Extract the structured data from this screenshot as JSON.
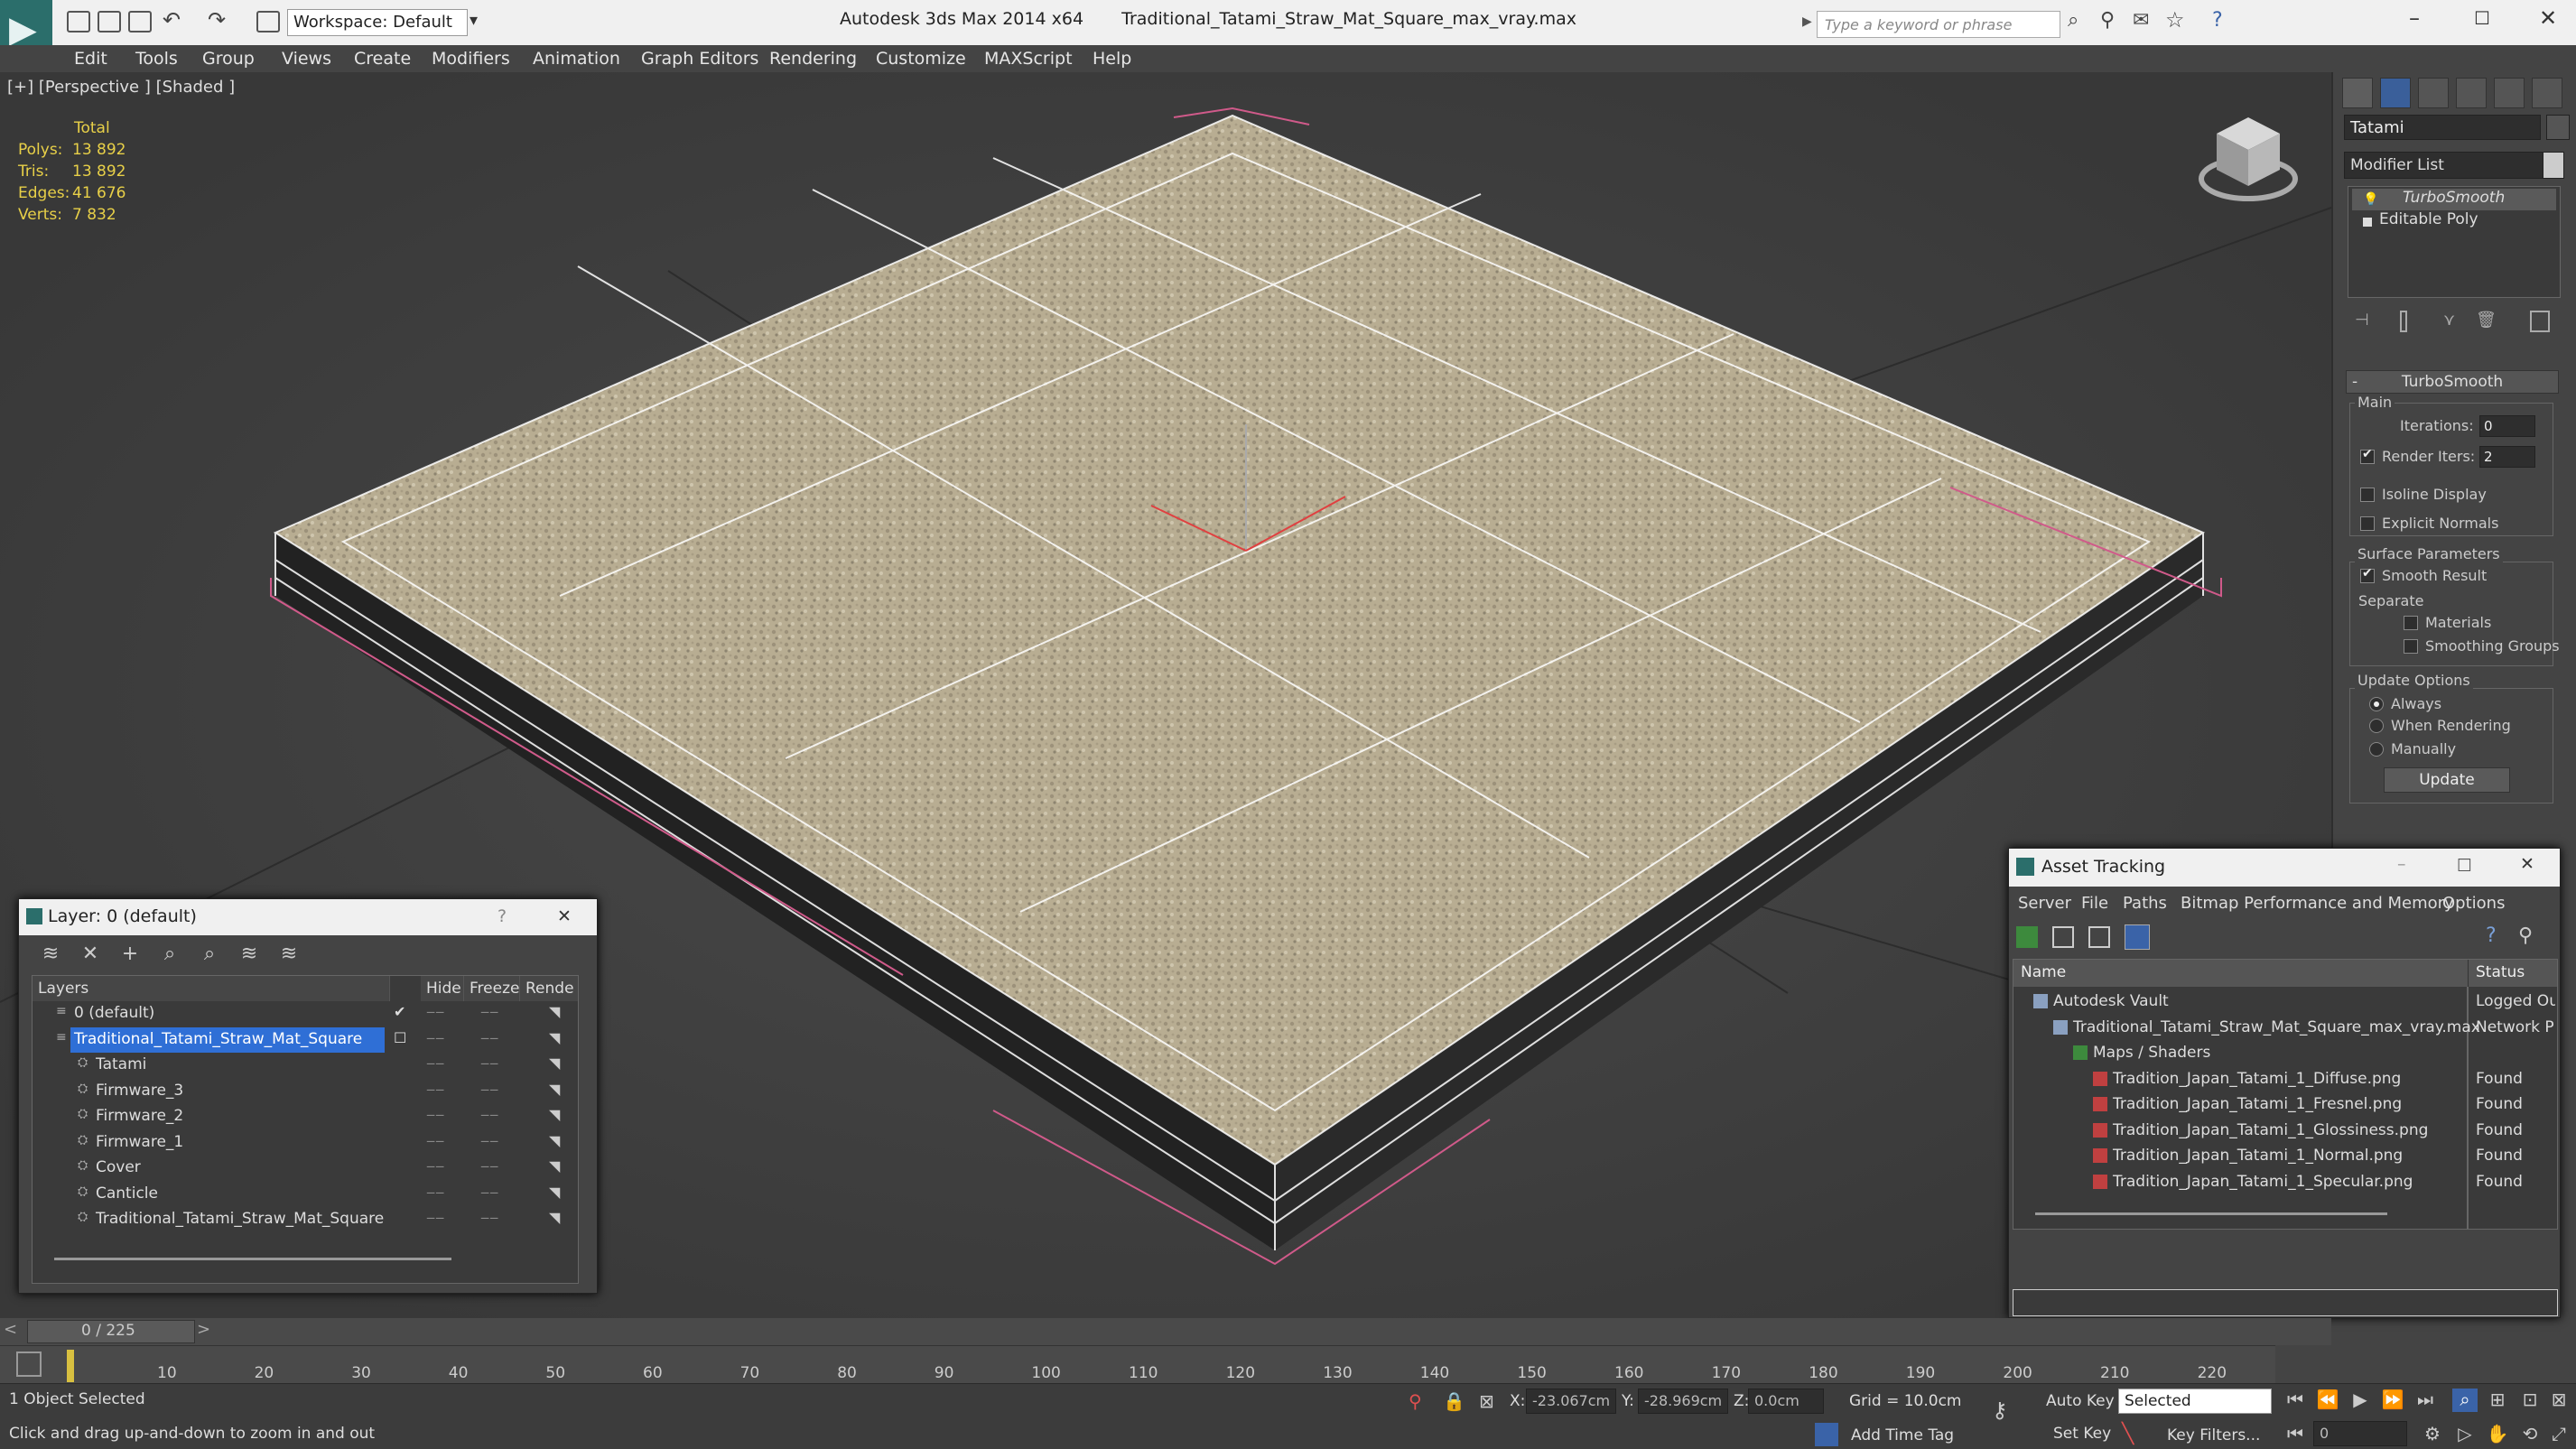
{
  "app": {
    "title": "Autodesk 3ds Max  2014 x64",
    "file": "Traditional_Tatami_Straw_Mat_Square_max_vray.max",
    "workspace": "Workspace: Default",
    "search_placeholder": "Type a keyword or phrase"
  },
  "menu": [
    "Edit",
    "Tools",
    "Group",
    "Views",
    "Create",
    "Modifiers",
    "Animation",
    "Graph Editors",
    "Rendering",
    "Customize",
    "MAXScript",
    "Help"
  ],
  "viewport": {
    "label": "[+] [Perspective ] [Shaded ]",
    "stats_header": "Total",
    "stats": [
      {
        "label": "Polys:",
        "value": "13 892"
      },
      {
        "label": "Tris:",
        "value": "13 892"
      },
      {
        "label": "Edges:",
        "value": "41 676"
      },
      {
        "label": "Verts:",
        "value": "7 832"
      }
    ]
  },
  "command_panel": {
    "object_name": "Tatami",
    "modifier_list": "Modifier List",
    "stack": [
      "TurboSmooth",
      "Editable Poly"
    ],
    "rollout": "TurboSmooth",
    "main_group": "Main",
    "iterations_label": "Iterations:",
    "iterations": "0",
    "render_iters_label": "Render Iters:",
    "render_iters": "2",
    "isoline": "Isoline Display",
    "explicit_normals": "Explicit Normals",
    "surface_group": "Surface Parameters",
    "smooth_result": "Smooth Result",
    "separate": "Separate",
    "materials": "Materials",
    "smoothing_groups": "Smoothing Groups",
    "update_group": "Update Options",
    "always": "Always",
    "when_rendering": "When Rendering",
    "manually": "Manually",
    "update_btn": "Update"
  },
  "layer_panel": {
    "title": "Layer: 0 (default)",
    "help": "?",
    "close": "✕",
    "columns": [
      "Layers",
      "Hide",
      "Freeze",
      "Rende"
    ],
    "rows": [
      {
        "name": "0 (default)",
        "indent": 0
      },
      {
        "name": "Traditional_Tatami_Straw_Mat_Square",
        "indent": 0
      },
      {
        "name": "Tatami",
        "indent": 1
      },
      {
        "name": "Firmware_3",
        "indent": 1
      },
      {
        "name": "Firmware_2",
        "indent": 1
      },
      {
        "name": "Firmware_1",
        "indent": 1
      },
      {
        "name": "Cover",
        "indent": 1
      },
      {
        "name": "Canticle",
        "indent": 1
      },
      {
        "name": "Traditional_Tatami_Straw_Mat_Square",
        "indent": 1
      }
    ]
  },
  "asset_panel": {
    "title": "Asset Tracking",
    "menu": [
      "Server",
      "File",
      "Paths",
      "Bitmap Performance and Memory",
      "Options"
    ],
    "columns": [
      "Name",
      "Status"
    ],
    "rows": [
      {
        "name": "Autodesk Vault",
        "status": "Logged Ou",
        "indent": 1
      },
      {
        "name": "Traditional_Tatami_Straw_Mat_Square_max_vray.max",
        "status": "Network P",
        "indent": 2
      },
      {
        "name": "Maps / Shaders",
        "status": "",
        "indent": 3
      },
      {
        "name": "Tradition_Japan_Tatami_1_Diffuse.png",
        "status": "Found",
        "indent": 4
      },
      {
        "name": "Tradition_Japan_Tatami_1_Fresnel.png",
        "status": "Found",
        "indent": 4
      },
      {
        "name": "Tradition_Japan_Tatami_1_Glossiness.png",
        "status": "Found",
        "indent": 4
      },
      {
        "name": "Tradition_Japan_Tatami_1_Normal.png",
        "status": "Found",
        "indent": 4
      },
      {
        "name": "Tradition_Japan_Tatami_1_Specular.png",
        "status": "Found",
        "indent": 4
      }
    ]
  },
  "timeline": {
    "frame": "0 / 225",
    "ticks": [
      "10",
      "20",
      "30",
      "40",
      "50",
      "60",
      "70",
      "80",
      "90",
      "100",
      "110",
      "120",
      "130",
      "140",
      "150",
      "160",
      "170",
      "180",
      "190",
      "200",
      "210",
      "220"
    ]
  },
  "status": {
    "selection": "1 Object Selected",
    "hint": "Click and drag up-and-down to zoom in and out",
    "x": "-23.067cm",
    "y": "-28.969cm",
    "z": "0.0cm",
    "grid": "Grid = 10.0cm",
    "add_time_tag": "Add Time Tag",
    "auto_key": "Auto Key",
    "set_key": "Set Key",
    "selected": "Selected",
    "key_filters": "Key Filters...",
    "frame_field": "0"
  }
}
